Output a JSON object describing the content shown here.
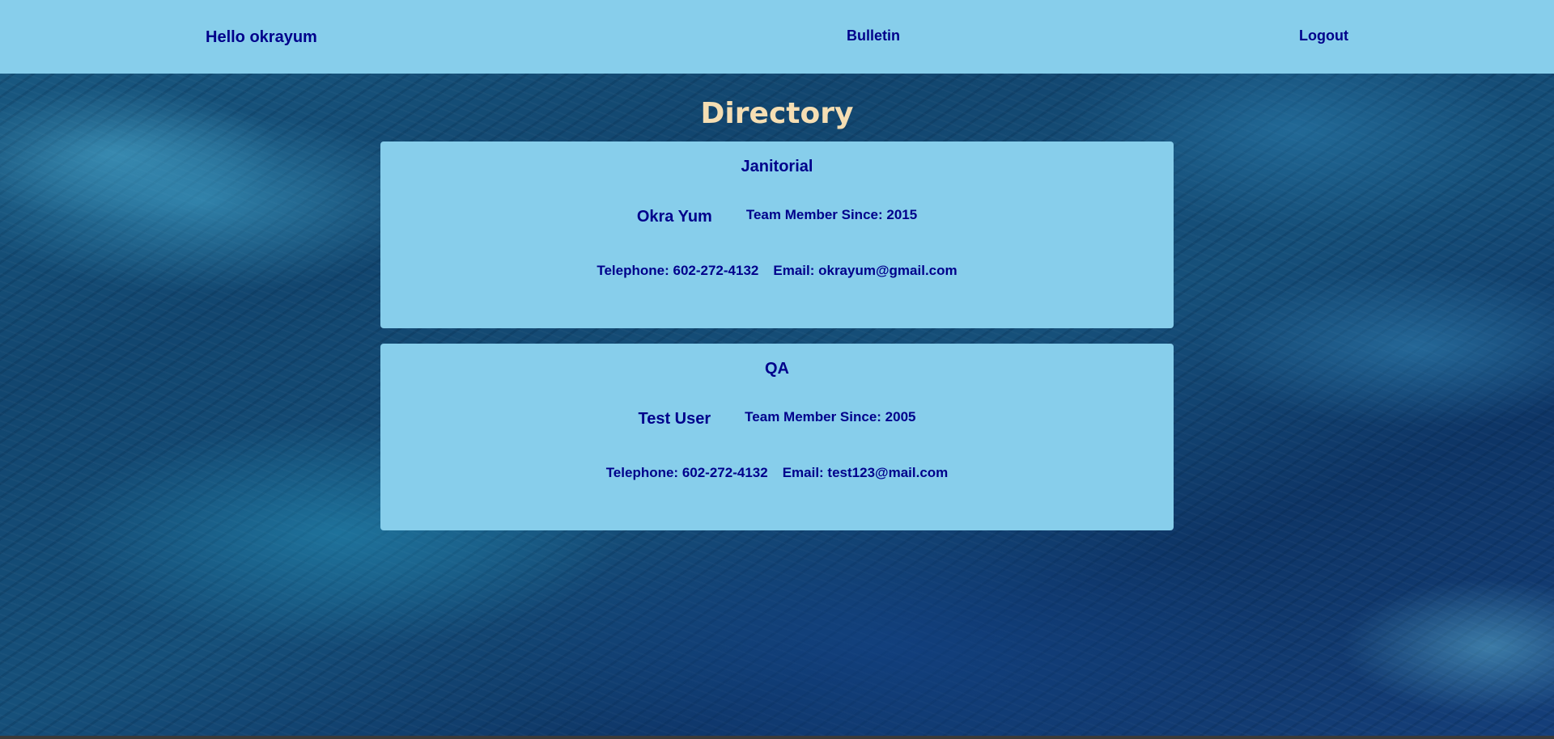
{
  "nav": {
    "greeting": "Hello okrayum",
    "bulletin": "Bulletin",
    "logout": "Logout"
  },
  "page": {
    "title": "Directory"
  },
  "departments": [
    {
      "name": "Janitorial",
      "member_name": "Okra Yum",
      "member_since": "Team Member Since: 2015",
      "telephone": "Telephone: 602-272-4132",
      "email": "Email: okrayum@gmail.com"
    },
    {
      "name": "QA",
      "member_name": "Test User",
      "member_since": "Team Member Since: 2005",
      "telephone": "Telephone: 602-272-4132",
      "email": "Email: test123@mail.com"
    }
  ],
  "colors": {
    "navbar": "#87ceeb",
    "card": "#87ceeb",
    "text": "#00008b",
    "title": "#f5deb3"
  }
}
